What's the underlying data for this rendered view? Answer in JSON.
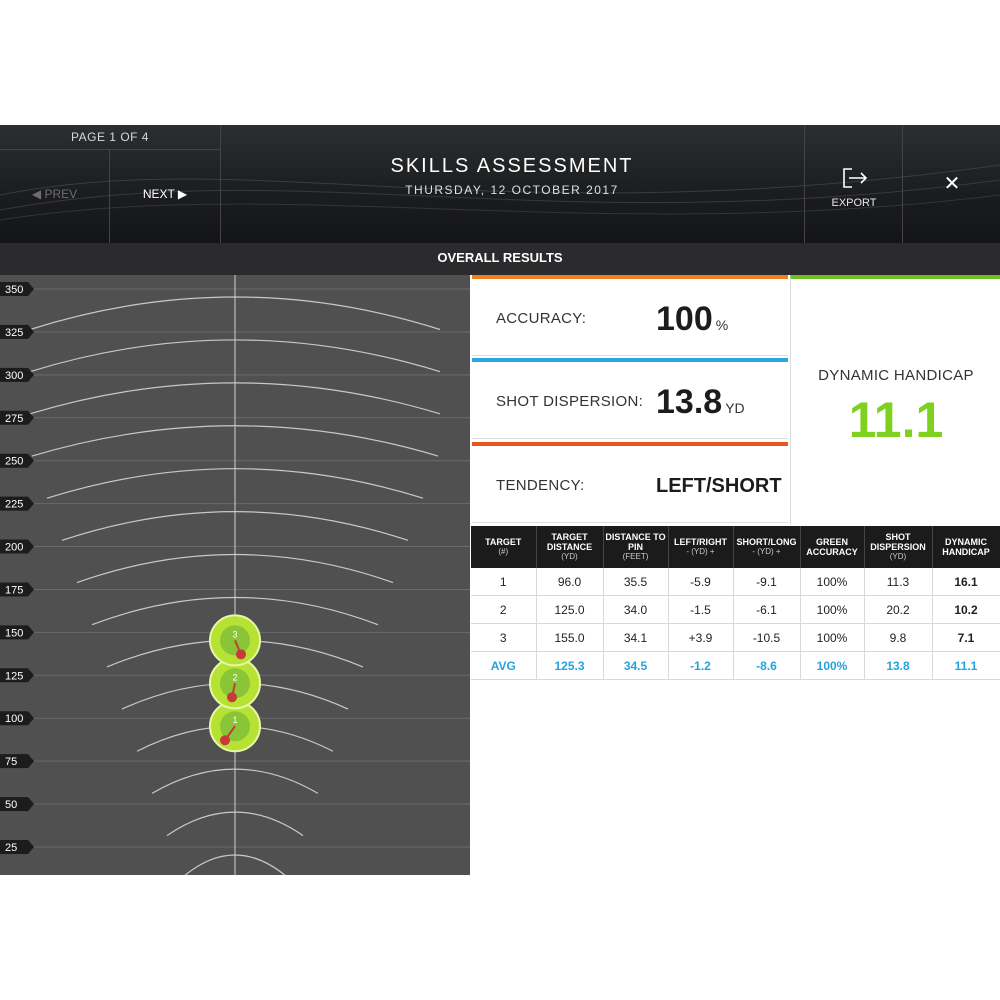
{
  "header": {
    "page_label": "PAGE 1 OF 4",
    "prev_label": "◀ PREV",
    "next_label": "NEXT ▶",
    "title": "SKILLS ASSESSMENT",
    "date": "THURSDAY, 12 OCTOBER 2017",
    "export_label": "EXPORT",
    "export_icon": "export-icon",
    "close_icon": "close-icon",
    "close_glyph": "✕"
  },
  "section_title": "OVERALL RESULTS",
  "chart": {
    "distance_labels": [
      "350",
      "325",
      "300",
      "275",
      "250",
      "225",
      "200",
      "175",
      "150",
      "125",
      "100",
      "75",
      "50",
      "25"
    ],
    "targets": [
      {
        "number": "1",
        "distance": 100
      },
      {
        "number": "2",
        "distance": 125
      },
      {
        "number": "3",
        "distance": 150
      }
    ]
  },
  "stats": {
    "accuracy_label": "ACCURACY:",
    "accuracy_value": "100",
    "accuracy_unit": "%",
    "dispersion_label": "SHOT DISPERSION:",
    "dispersion_value": "13.8",
    "dispersion_unit": "YD",
    "tendency_label": "TENDENCY:",
    "tendency_value": "LEFT/SHORT",
    "handicap_label": "DYNAMIC HANDICAP",
    "handicap_value": "11.1"
  },
  "colors": {
    "accuracy_accent": "#f07f1e",
    "dispersion_accent": "#2aa6e0",
    "tendency_accent": "#e8561c",
    "handicap_accent": "#6dc01a",
    "avg_row": "#23a3de",
    "target_green": "#b5e233",
    "shot_red": "#c63a3a"
  },
  "table": {
    "headers": [
      {
        "title": "TARGET",
        "sub": "(#)"
      },
      {
        "title": "TARGET DISTANCE",
        "sub": "(YD)"
      },
      {
        "title": "DISTANCE TO PIN",
        "sub": "(FEET)"
      },
      {
        "title": "LEFT/RIGHT",
        "sub": "- (YD) +"
      },
      {
        "title": "SHORT/LONG",
        "sub": "- (YD) +"
      },
      {
        "title": "GREEN ACCURACY",
        "sub": ""
      },
      {
        "title": "SHOT DISPERSION",
        "sub": "(YD)"
      },
      {
        "title": "DYNAMIC HANDICAP",
        "sub": ""
      }
    ],
    "rows": [
      [
        "1",
        "96.0",
        "35.5",
        "-5.9",
        "-9.1",
        "100%",
        "11.3",
        "16.1"
      ],
      [
        "2",
        "125.0",
        "34.0",
        "-1.5",
        "-6.1",
        "100%",
        "20.2",
        "10.2"
      ],
      [
        "3",
        "155.0",
        "34.1",
        "+3.9",
        "-10.5",
        "100%",
        "9.8",
        "7.1"
      ]
    ],
    "avg": [
      "AVG",
      "125.3",
      "34.5",
      "-1.2",
      "-8.6",
      "100%",
      "13.8",
      "11.1"
    ]
  }
}
